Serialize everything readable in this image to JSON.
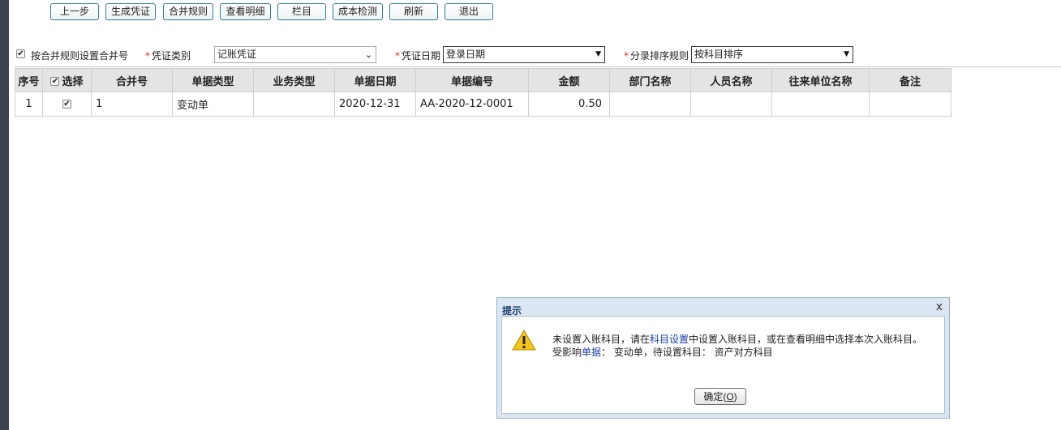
{
  "toolbar": {
    "buttons": [
      "上一步",
      "生成凭证",
      "合并规则",
      "查看明细",
      "栏目",
      "成本检测",
      "刷新",
      "退出"
    ]
  },
  "filters": {
    "merge_by_rule": {
      "checked": true,
      "label": "按合并规则设置合并号"
    },
    "voucher_type": {
      "required_mark": "*",
      "label": "凭证类别",
      "value": "记账凭证"
    },
    "voucher_date": {
      "required_mark": "*",
      "label": "凭证日期",
      "value": "登录日期"
    },
    "entry_sort": {
      "required_mark": "*",
      "label": "分录排序规则",
      "value": "按科目排序"
    }
  },
  "table": {
    "headers": [
      "序号",
      "选择",
      "合并号",
      "单据类型",
      "业务类型",
      "单据日期",
      "单据编号",
      "金额",
      "部门名称",
      "人员名称",
      "往来单位名称",
      "备注"
    ],
    "select_all_checked": true,
    "rows": [
      {
        "seq": "1",
        "selected": true,
        "merge_no": "1",
        "doc_type": "变动单",
        "biz_type": "",
        "doc_date": "2020-12-31",
        "doc_no": "AA-2020-12-0001",
        "amount": "0.50",
        "dept": "",
        "person": "",
        "partner": "",
        "remark": ""
      }
    ]
  },
  "dialog": {
    "title": "提示",
    "close_glyph": "x",
    "line1_a": "未设置入账科目，请在",
    "line1_link": "科目设置",
    "line1_b": "中设置入账科目，或在查看明细中选择本次入账科目。",
    "line2_a": "受影响",
    "line2_link": "单据",
    "line2_b": "： 变动单，待设置科目： 资产对方科目",
    "ok_label_a": "确定(",
    "ok_label_key": "O",
    "ok_label_b": ")"
  },
  "colors": {
    "accent_border": "#2f7f8f",
    "link": "#1a3fb5",
    "required": "#e0301e",
    "dialog_title": "#1d3f6e"
  }
}
